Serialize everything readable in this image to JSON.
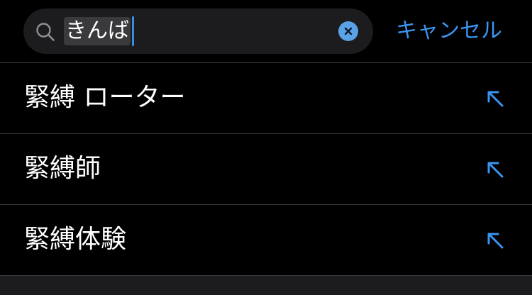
{
  "search": {
    "query": "きんば",
    "cancel_label": "キャンセル"
  },
  "icons": {
    "search": "magnifier-icon",
    "clear": "x-circle-icon",
    "fill": "arrow-up-left-icon"
  },
  "colors": {
    "accent": "#3a95f0",
    "background": "#000000",
    "field": "#1c1c1e",
    "separator": "#38383a"
  },
  "suggestions": [
    {
      "label": "緊縛 ローター"
    },
    {
      "label": "緊縛師"
    },
    {
      "label": "緊縛体験"
    }
  ]
}
